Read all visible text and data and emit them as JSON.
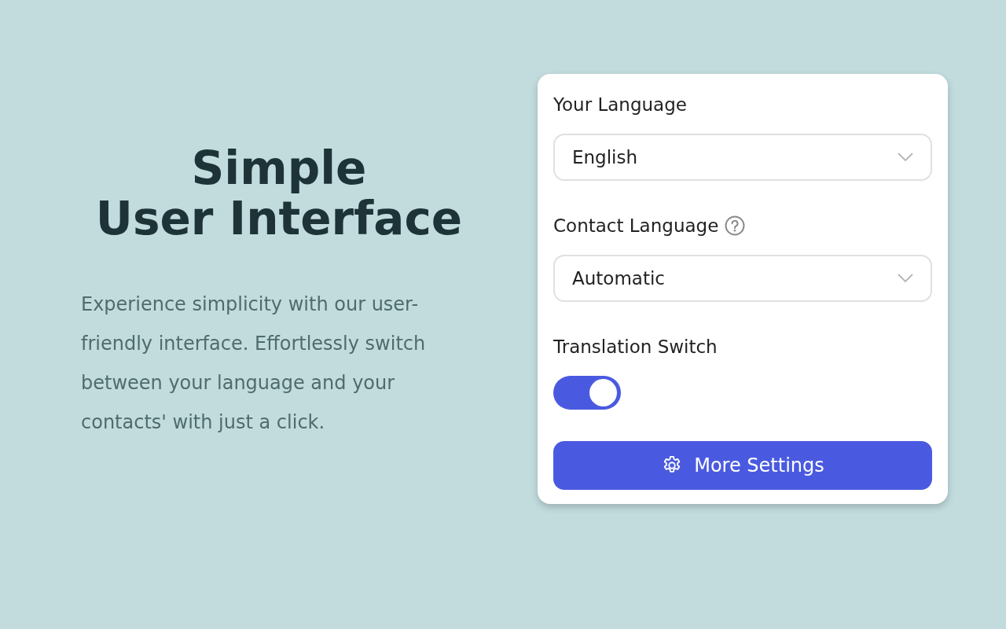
{
  "hero": {
    "title_lines": [
      "Simple",
      "User Interface"
    ],
    "description": "Experience simplicity with our user-friendly interface. Effortlessly switch between your language and your contacts' with just a click."
  },
  "settings": {
    "fields": [
      {
        "kind": "select",
        "label": "Your Language",
        "value": "English",
        "help": false
      },
      {
        "kind": "select",
        "label": "Contact Language",
        "value": "Automatic",
        "help": true
      },
      {
        "kind": "toggle",
        "label": "Translation Switch",
        "on": true
      }
    ],
    "button": "More Settings"
  }
}
